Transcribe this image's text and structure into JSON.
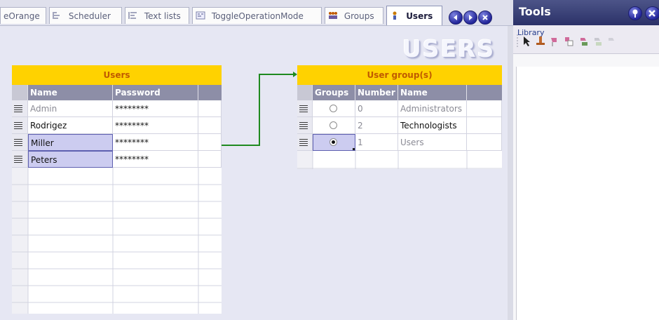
{
  "tabs": [
    {
      "label": "eOrange",
      "icon": "tab-icon"
    },
    {
      "label": "Scheduler",
      "icon": "scheduler-icon"
    },
    {
      "label": "Text lists",
      "icon": "text-lists-icon"
    },
    {
      "label": "ToggleOperationMode",
      "icon": "script-icon"
    },
    {
      "label": "Groups",
      "icon": "groups-icon"
    },
    {
      "label": "Users",
      "icon": "users-icon",
      "active": true
    }
  ],
  "watermark": "USERS",
  "users_table": {
    "title": "Users",
    "columns": [
      "Name",
      "Password"
    ],
    "rows": [
      {
        "name": "Admin",
        "password": "********"
      },
      {
        "name": "Rodrigez",
        "password": "********"
      },
      {
        "name": "Miller",
        "password": "********"
      },
      {
        "name": "Peters",
        "password": "********"
      }
    ]
  },
  "groups_table": {
    "title": "User group(s)",
    "columns": [
      "Groups",
      "Number",
      "Name"
    ],
    "rows": [
      {
        "selected": false,
        "number": "0",
        "name": "Administrators"
      },
      {
        "selected": false,
        "number": "2",
        "name": "Technologists"
      },
      {
        "selected": true,
        "number": "1",
        "name": "Users"
      }
    ]
  },
  "tools": {
    "title": "Tools",
    "library_label": "Library"
  },
  "colors": {
    "title_bar": "#ffd200",
    "header": "#8d8ea7",
    "connector": "#1f8a1f",
    "accent": "#2b3168"
  }
}
